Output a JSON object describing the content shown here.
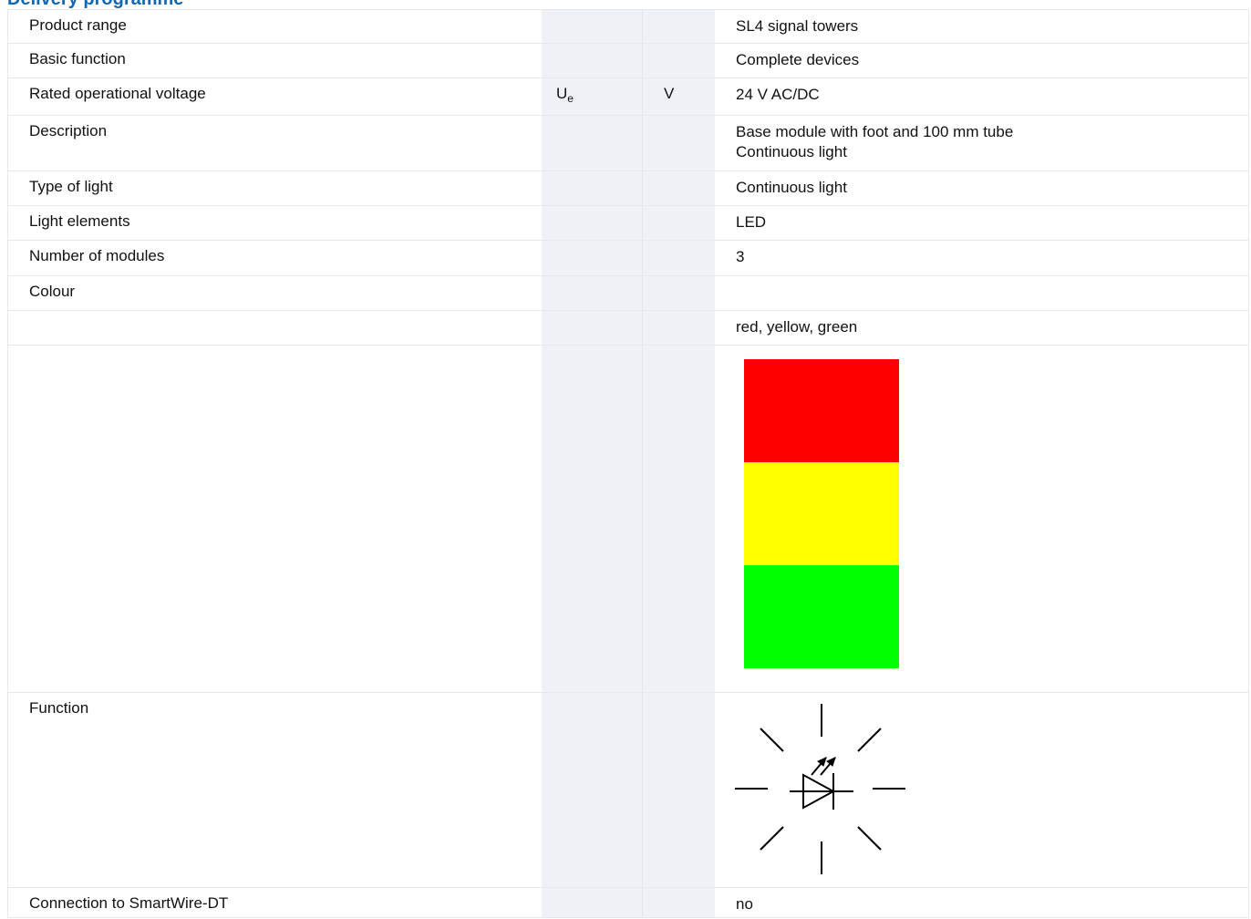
{
  "heading": "Delivery programme",
  "rows": {
    "product_range": {
      "label": "Product range",
      "value": "SL4 signal towers"
    },
    "basic_function": {
      "label": "Basic function",
      "value": "Complete devices"
    },
    "rated_voltage": {
      "label": "Rated operational voltage",
      "symbol": "U",
      "symbol_sub": "e",
      "unit": "V",
      "value": "24 V AC/DC"
    },
    "description": {
      "label": "Description",
      "value_line1": "Base module with foot and 100 mm tube",
      "value_line2": "Continuous light"
    },
    "type_of_light": {
      "label": "Type of light",
      "value": "Continuous light"
    },
    "light_elements": {
      "label": "Light elements",
      "value": "LED"
    },
    "number_of_modules": {
      "label": "Number of modules",
      "value": "3"
    },
    "colour": {
      "label": "Colour"
    },
    "colour_value": {
      "value": "red, yellow, green"
    },
    "function": {
      "label": "Function",
      "icon": "led-flashing-light-icon"
    },
    "smartwire": {
      "label": "Connection to SmartWire-DT",
      "value": "no"
    }
  },
  "tower_colors": [
    "#ff0000",
    "#ffff00",
    "#00ff00"
  ],
  "colors": {
    "heading": "#1467b3",
    "unit_column": "#eff1f6",
    "border": "#e6e8ee"
  }
}
